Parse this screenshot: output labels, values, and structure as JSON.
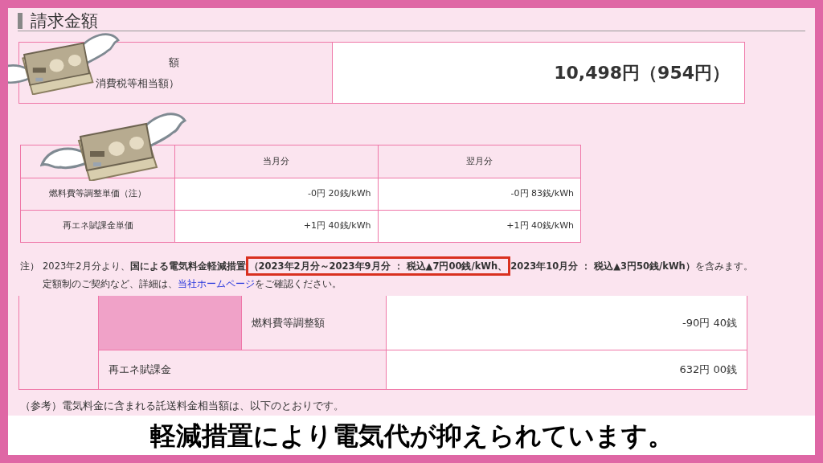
{
  "heading": "請求金額",
  "total": {
    "label_lines": [
      "額",
      "消費税等相当額）"
    ],
    "value": "10,498円（954円）"
  },
  "unit_price_table": {
    "columns": [
      "当月分",
      "翌月分"
    ],
    "rows": [
      {
        "label": "燃料費等調整単価（注）",
        "values": [
          "-0円 20銭/kWh",
          "-0円 83銭/kWh"
        ]
      },
      {
        "label": "再エネ賦課金単価",
        "values": [
          "+1円 40銭/kWh",
          "+1円 40銭/kWh"
        ]
      }
    ]
  },
  "note": {
    "prefix": "注）",
    "before": "2023年2月分より、**国による電気料金軽減措置**",
    "highlighted": "**（2023年2月分～2023年9月分 ： 税込▲7円00銭/kWh、**",
    "after": "**2023年10月分 ： 税込▲3円50銭/kWh）**を含みます。",
    "line2_before": "定額制のご契約など、詳細は、",
    "link": "当社ホームページ",
    "line2_after": "をご確認ください。"
  },
  "charges_table": {
    "rows": [
      {
        "label": "燃料費等調整額",
        "value": "-90円 40銭",
        "kind": "sub"
      },
      {
        "label": "再エネ賦課金",
        "value": "632円 00銭",
        "kind": "main"
      }
    ]
  },
  "reference": "（参考）電気料金に含まれる託送料金相当額は、以下のとおりです。",
  "subtitle": "軽減措置により電気代が抑えられています。"
}
